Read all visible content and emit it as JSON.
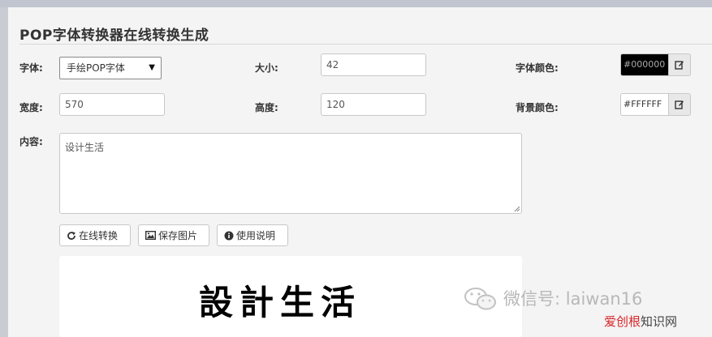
{
  "page": {
    "title": "POP字体转换器在线转换生成"
  },
  "form": {
    "font_label": "字体:",
    "font_value": "手绘POP字体",
    "size_label": "大小:",
    "size_value": "42",
    "font_color_label": "字体颜色:",
    "font_color_value": "#000000",
    "width_label": "宽度:",
    "width_value": "570",
    "height_label": "高度:",
    "height_value": "120",
    "bg_color_label": "背景颜色:",
    "bg_color_value": "#FFFFFF",
    "content_label": "内容:",
    "content_value": "设计生活"
  },
  "buttons": {
    "convert": "在线转换",
    "save": "保存图片",
    "help": "使用说明"
  },
  "preview": {
    "text": "設計生活"
  },
  "watermark": {
    "wechat": "微信号: laiwan16",
    "site_red": "爱创根",
    "site_dark": "知识网"
  },
  "colors": {
    "font_swatch_bg": "#000000",
    "font_swatch_text": "#aaaaaa",
    "bg_swatch_bg": "#FFFFFF",
    "watermark_red": "#d9262a"
  },
  "icons": {
    "select_arrow": "caret-down-icon",
    "color_picker": "edit-icon",
    "convert": "refresh-icon",
    "save": "image-icon",
    "help": "info-icon",
    "wechat": "wechat-icon"
  }
}
